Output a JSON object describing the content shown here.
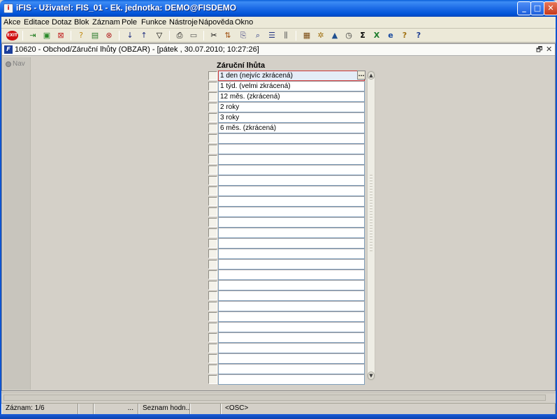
{
  "window": {
    "title": "iFIS - Uživatel: FIS_01 - Ek. jednotka: DEMO@FISDEMO",
    "icon": "iFIS-app-icon",
    "minimize_label": "_",
    "maximize_label": "□",
    "close_label": "✕"
  },
  "menu": [
    "Akce",
    "Editace",
    "Dotaz",
    "Blok",
    "Záznam",
    "Pole",
    "Funkce",
    "Nástroje",
    "Nápověda",
    "Okno"
  ],
  "toolbar": {
    "exit_label": "EXIT",
    "icons": [
      "exit-icon",
      "save-icon",
      "insert-record-icon",
      "delete-record-icon",
      "enter-query-icon",
      "execute-query-icon",
      "cancel-query-icon",
      "sort-asc-icon",
      "sort-desc-icon",
      "filter-icon",
      "print-icon",
      "print-preview-icon",
      "cut-icon",
      "copy-icon",
      "paste-icon",
      "find-icon",
      "list-icon",
      "columns-icon",
      "calculator-icon",
      "tools-icon",
      "chart-icon",
      "clock-icon",
      "sum-icon",
      "excel-icon",
      "ie-icon",
      "help-cursor-icon",
      "help-icon"
    ]
  },
  "form": {
    "title": "10620 - Obchod/Záruční lhůty (OBZAR) - [pátek  , 30.07.2010; 10:27:26]",
    "restore_label": "🗗",
    "close_label": "✕",
    "nav_label": "Nav",
    "column_header": "Záruční lhůta",
    "lov_button": "...",
    "rows": [
      "1 den (nejvíc zkrácená)",
      "1 týd. (velmi zkrácená)",
      "12 měs. (zkrácená)",
      "2 roky",
      "3 roky",
      "6 měs. (zkrácená)",
      "",
      "",
      "",
      "",
      "",
      "",
      "",
      "",
      "",
      "",
      "",
      "",
      "",
      "",
      "",
      "",
      "",
      "",
      "",
      "",
      "",
      "",
      "",
      ""
    ],
    "scroll_up": "▲",
    "scroll_down": "▼"
  },
  "status": {
    "record": "Záznam: 1/6",
    "seg2": "",
    "seg3": "...",
    "list_label": "Seznam hodn...",
    "seg5": "",
    "mode": "<OSC>"
  }
}
